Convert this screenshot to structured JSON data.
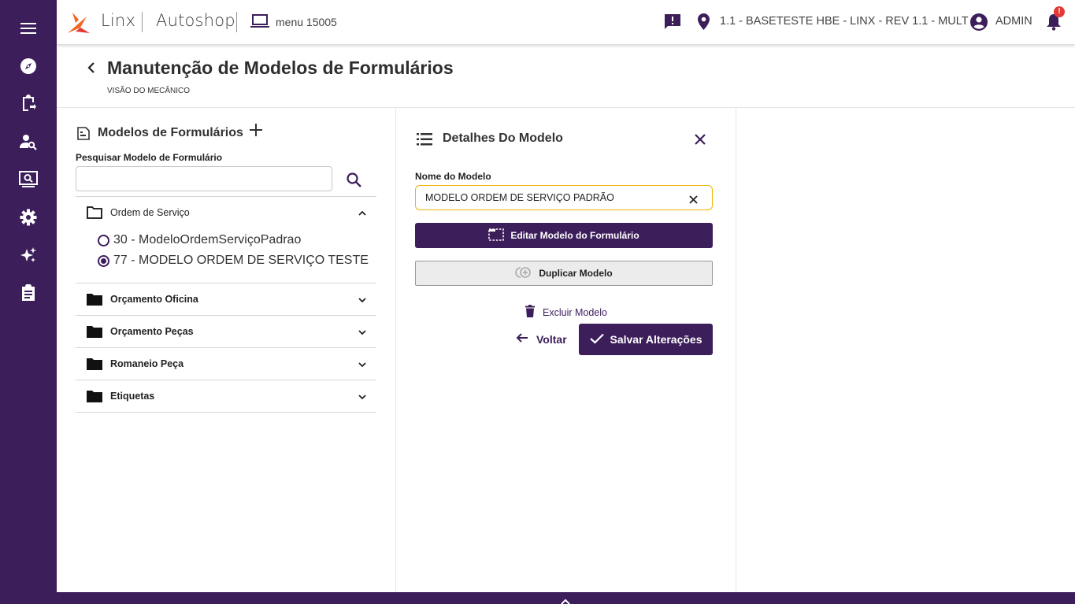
{
  "app": {
    "brand": "Linx",
    "product": "Autoshop",
    "menu_code": "menu 15005",
    "location": "1.1 - BASETESTE HBE - LINX - REV 1.1 - MULT",
    "user": "ADMIN",
    "notification_badge": "!"
  },
  "colors": {
    "primary": "#3c1e5a",
    "accent": "#f0b400",
    "badge": "#e53935",
    "logo_orange": "#f26522"
  },
  "sidebar": {
    "items": [
      {
        "icon": "menu-icon"
      },
      {
        "icon": "compass-icon"
      },
      {
        "icon": "clipboard-transfer-icon"
      },
      {
        "icon": "person-search-icon"
      },
      {
        "icon": "screen-search-icon"
      },
      {
        "icon": "gear-icon"
      },
      {
        "icon": "sparkles-icon"
      },
      {
        "icon": "clipboard-list-icon"
      }
    ]
  },
  "page": {
    "title": "Manutenção de Modelos de Formulários",
    "subtitle": "VISÃO DO MECÂNICO"
  },
  "left": {
    "title": "Modelos de Formulários",
    "search_label": "Pesquisar Modelo de Formulário",
    "search_value": "",
    "groups": [
      {
        "label": "Ordem de Serviço",
        "expanded": true,
        "items": [
          {
            "label": "30 - ModeloOrdemServiçoPadrao",
            "selected": false
          },
          {
            "label": "77 - MODELO ORDEM DE SERVIÇO TESTE",
            "selected": true
          }
        ]
      },
      {
        "label": "Orçamento Oficina",
        "expanded": false
      },
      {
        "label": "Orçamento Peças",
        "expanded": false
      },
      {
        "label": "Romaneio Peça",
        "expanded": false
      },
      {
        "label": "Etiquetas",
        "expanded": false
      }
    ]
  },
  "details": {
    "title": "Detalhes Do Modelo",
    "name_label": "Nome do Modelo",
    "name_value": "MODELO ORDEM DE SERVIÇO PADRÃO",
    "edit_label": "Editar Modelo do Formulário",
    "duplicate_label": "Duplicar Modelo",
    "delete_label": "Excluir Modelo",
    "back_label": "Voltar",
    "save_label": "Salvar Alterações"
  }
}
